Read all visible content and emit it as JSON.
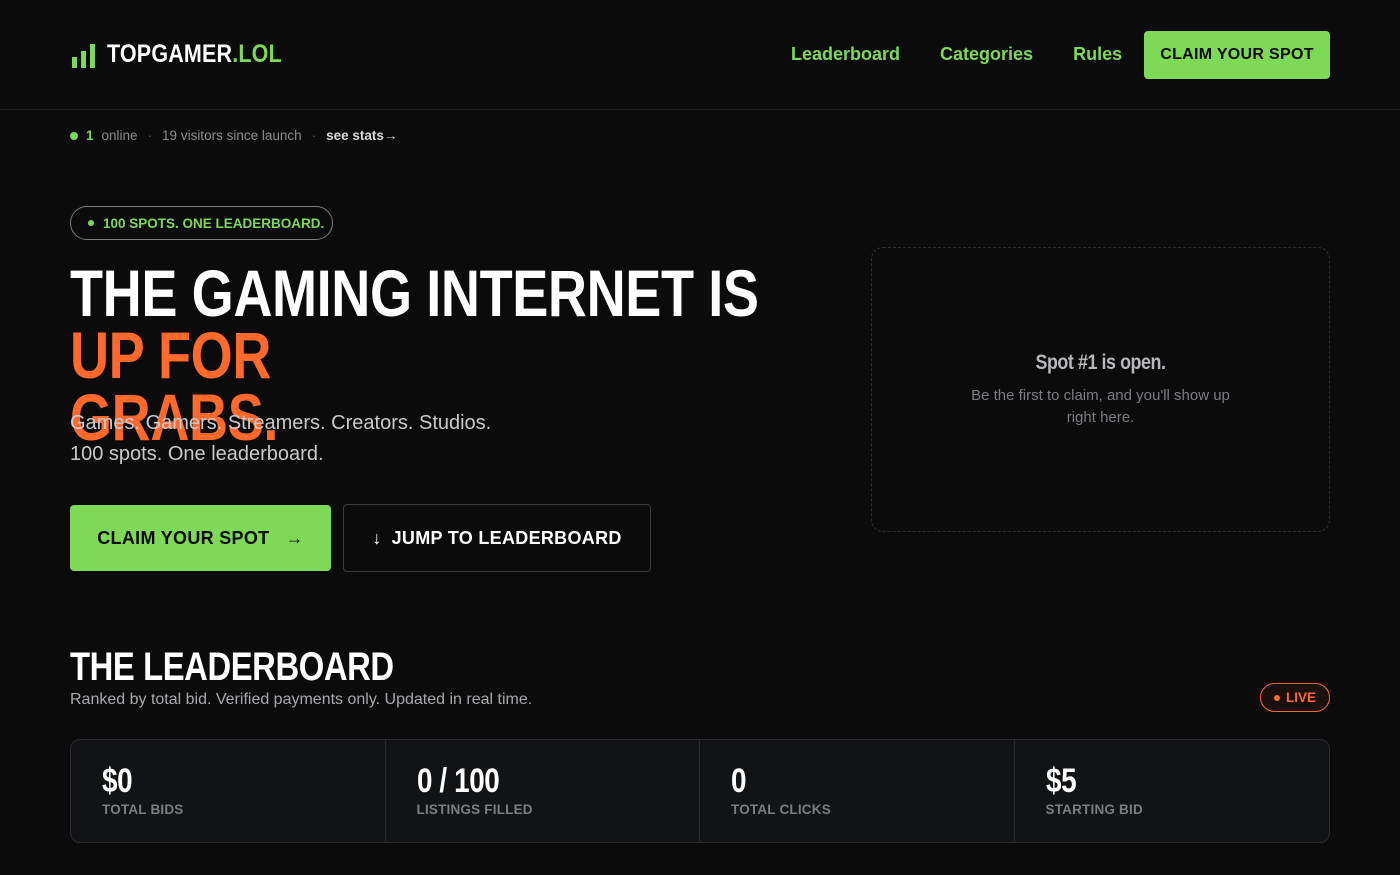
{
  "header": {
    "logo_main": "TOPGAMER",
    "logo_accent": ".LOL",
    "nav": [
      {
        "label": "Leaderboard"
      },
      {
        "label": "Categories"
      },
      {
        "label": "Rules"
      }
    ],
    "cta_label": "CLAIM YOUR SPOT"
  },
  "status": {
    "online_count": "1",
    "online_label": "online",
    "visitors_text": "19 visitors since launch",
    "stats_link": "see stats→"
  },
  "hero": {
    "pill_text": "100 SPOTS. ONE LEADERBOARD.",
    "title_white": "THE GAMING INTERNET IS ",
    "title_orange_1": "UP FOR",
    "title_orange_2": "GRABS.",
    "subtitle_line1": "Games. Gamers. Streamers. Creators. Studios.",
    "subtitle_line2": "100 spots. One leaderboard.",
    "primary_button": "CLAIM YOUR SPOT",
    "primary_button_arrow": "→",
    "secondary_button": "JUMP TO LEADERBOARD",
    "secondary_button_arrow": "↓"
  },
  "spot_card": {
    "title": "Spot #1 is open.",
    "description": "Be the first to claim, and you'll show up right here."
  },
  "leaderboard": {
    "title": "THE LEADERBOARD",
    "subtitle": "Ranked by total bid. Verified payments only. Updated in real time.",
    "live_label": "LIVE",
    "stats": [
      {
        "value": "$0",
        "label": "TOTAL BIDS"
      },
      {
        "value": "0 / 100",
        "label": "LISTINGS FILLED"
      },
      {
        "value": "0",
        "label": "TOTAL CLICKS"
      },
      {
        "value": "$5",
        "label": "STARTING BID"
      }
    ]
  },
  "colors": {
    "background": "#0b0b0c",
    "accent_green": "#7ed957",
    "accent_orange": "#ff6a2c"
  }
}
